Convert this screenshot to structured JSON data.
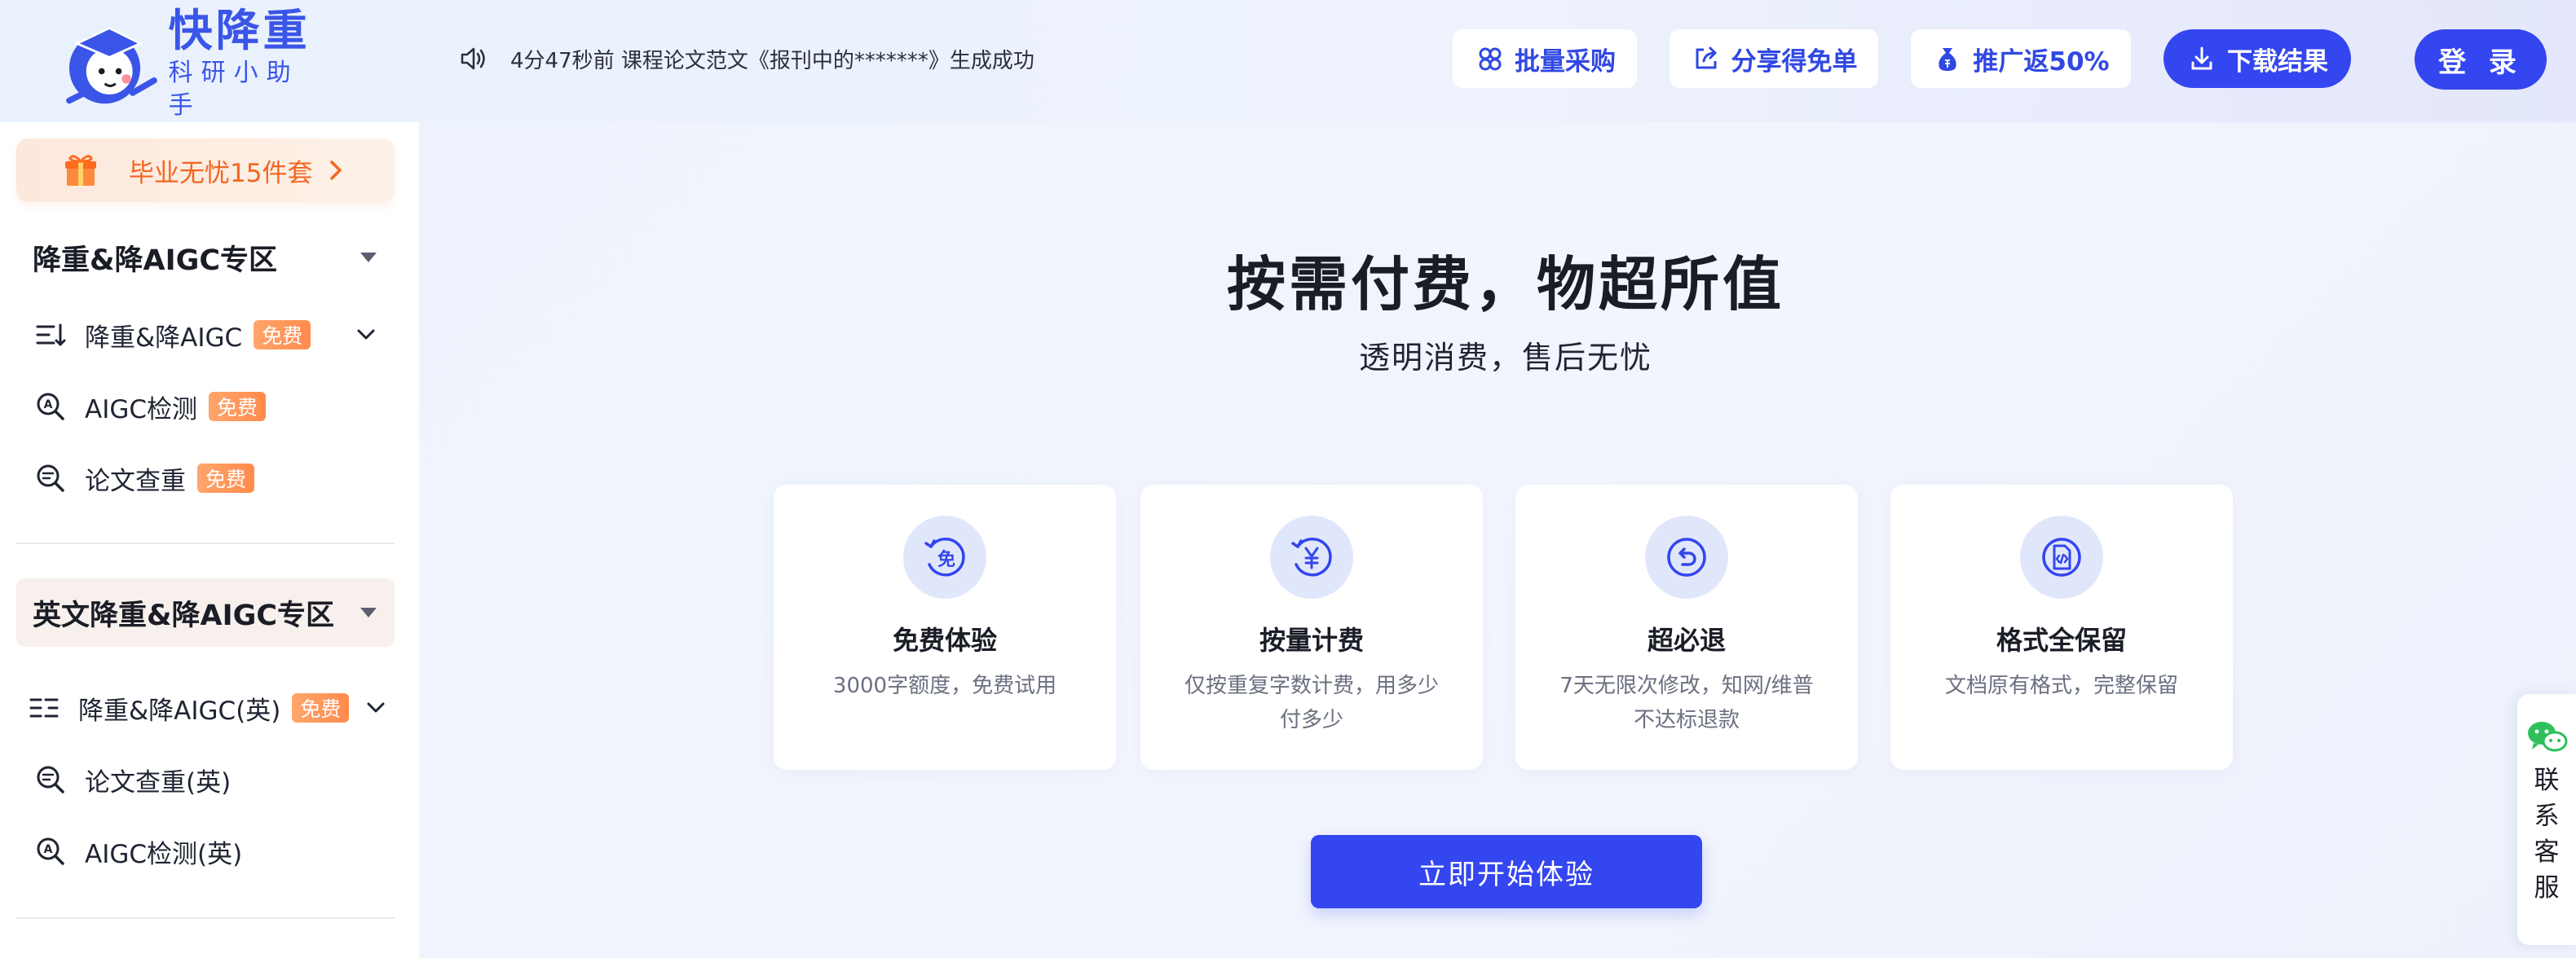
{
  "header": {
    "logo": {
      "title": "快降重",
      "subtitle": "科研小助手"
    },
    "notice": {
      "icon": "speaker-icon",
      "text": "4分47秒前 课程论文范文《报刊中的*******》生成成功"
    },
    "buttons": [
      {
        "label": "批量采购",
        "icon": "team-icon"
      },
      {
        "label": "分享得免单",
        "icon": "share-icon"
      },
      {
        "label": "推广返50%",
        "icon": "money-bag-icon"
      },
      {
        "label": "下载结果",
        "icon": "download-icon"
      }
    ],
    "login_label": "登 录"
  },
  "sidebar": {
    "promo": {
      "label": "毕业无忧15件套",
      "icon": "gift-icon"
    },
    "sections": [
      {
        "title": "降重&降AIGC专区",
        "items": [
          {
            "label": "降重&降AIGC",
            "badge": "免费",
            "icon": "sort-list-icon",
            "expandable": true
          },
          {
            "label": "AIGC检测",
            "badge": "免费",
            "icon": "ai-search-icon"
          },
          {
            "label": "论文查重",
            "badge": "免费",
            "icon": "doc-search-icon"
          }
        ]
      },
      {
        "title": "英文降重&降AIGC专区",
        "items": [
          {
            "label": "降重&降AIGC(英)",
            "badge": "免费",
            "icon": "list-indent-icon",
            "expandable": true
          },
          {
            "label": "论文查重(英)",
            "icon": "doc-search-icon"
          },
          {
            "label": "AIGC检测(英)",
            "icon": "ai-search-icon"
          }
        ]
      }
    ]
  },
  "main": {
    "headline": "按需付费，物超所值",
    "subline": "透明消费，售后无忧",
    "features": [
      {
        "title": "免费体验",
        "desc": "3000字额度，免费试用",
        "icon": "free-icon"
      },
      {
        "title": "按量计费",
        "desc": "仅按重复字数计费，用多少付多少",
        "icon": "yen-icon"
      },
      {
        "title": "超必退",
        "desc": "7天无限次修改，知网/维普不达标退款",
        "icon": "refund-icon"
      },
      {
        "title": "格式全保留",
        "desc": "文档原有格式，完整保留",
        "icon": "code-doc-icon"
      }
    ],
    "cta_label": "立即开始体验"
  },
  "contact": {
    "label": "联系客服",
    "icon": "wechat-icon"
  },
  "colors": {
    "primary": "#3446ef",
    "badge": "#ff8b4c",
    "promo_text": "#f2661f"
  }
}
